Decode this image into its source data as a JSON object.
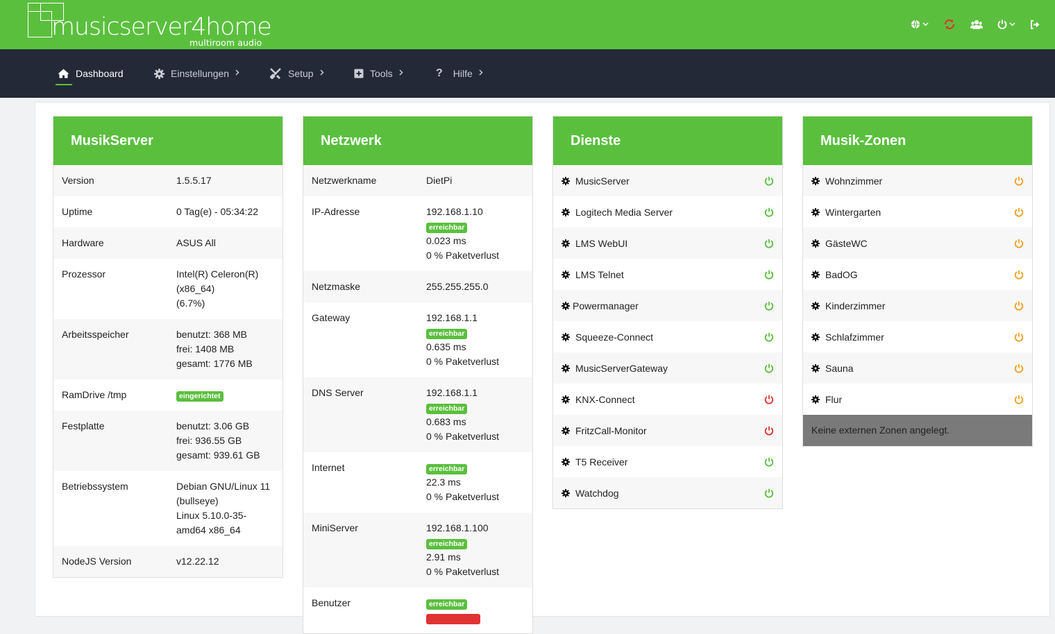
{
  "brand": {
    "name": "musicserver4home",
    "subtitle": "multiroom audio"
  },
  "topbar": {
    "icons": [
      "globe-icon",
      "sync-icon",
      "users-icon",
      "power-icon",
      "logout-icon"
    ],
    "sync_color": "#e03333"
  },
  "nav": {
    "items": [
      {
        "label": "Dashboard",
        "icon": "home-icon"
      },
      {
        "label": "Einstellungen",
        "icon": "gear-icon"
      },
      {
        "label": "Setup",
        "icon": "tools-icon"
      },
      {
        "label": "Tools",
        "icon": "plus-square-icon"
      },
      {
        "label": "Hilfe",
        "icon": "question-icon"
      }
    ]
  },
  "musikserver": {
    "title": "MusikServer",
    "rows": [
      {
        "k": "Version",
        "v": [
          "1.5.5.17"
        ]
      },
      {
        "k": "Uptime",
        "v": [
          "0 Tag(e) - 05:34:22"
        ]
      },
      {
        "k": "Hardware",
        "v": [
          "ASUS All"
        ]
      },
      {
        "k": "Prozessor",
        "v": [
          "Intel(R) Celeron(R)",
          "(x86_64)",
          "(6.7%)"
        ]
      },
      {
        "k": "Arbeitsspeicher",
        "v": [
          "benutzt: 368 MB",
          "frei: 1408 MB",
          "gesamt: 1776 MB"
        ]
      },
      {
        "k": "RamDrive /tmp",
        "badge": "eingerichtet"
      },
      {
        "k": "Festplatte",
        "v": [
          "benutzt: 3.06 GB",
          "frei: 936.55 GB",
          "gesamt: 939.61 GB"
        ]
      },
      {
        "k": "Betriebssystem",
        "v": [
          "Debian GNU/Linux 11",
          "(bullseye)",
          "Linux 5.10.0-35-",
          "amd64 x86_64"
        ]
      },
      {
        "k": "NodeJS Version",
        "v": [
          "v12.22.12"
        ]
      }
    ]
  },
  "netzwerk": {
    "title": "Netzwerk",
    "rows": [
      {
        "k": "Netzwerkname",
        "v": [
          "DietPi"
        ]
      },
      {
        "k": "IP-Adresse",
        "v": [
          "192.168.1.10"
        ],
        "badge": "erreichbar",
        "after": [
          "0.023 ms",
          "0 % Paketverlust"
        ]
      },
      {
        "k": "Netzmaske",
        "v": [
          "255.255.255.0"
        ]
      },
      {
        "k": "Gateway",
        "v": [
          "192.168.1.1"
        ],
        "badge": "erreichbar",
        "after": [
          "0.635 ms",
          "0 % Paketverlust"
        ]
      },
      {
        "k": "DNS Server",
        "v": [
          "192.168.1.1"
        ],
        "badge": "erreichbar",
        "after": [
          "0.683 ms",
          "0 % Paketverlust"
        ]
      },
      {
        "k": "Internet",
        "badge": "erreichbar",
        "after": [
          "22.3 ms",
          "0 % Paketverlust"
        ]
      },
      {
        "k": "MiniServer",
        "v": [
          "192.168.1.100"
        ],
        "badge": "erreichbar",
        "after": [
          "2.91 ms",
          "0 % Paketverlust"
        ]
      },
      {
        "k": "Benutzer",
        "badge": "erreichbar"
      }
    ]
  },
  "dienste": {
    "title": "Dienste",
    "items": [
      {
        "label": "MusicServer",
        "status": "on"
      },
      {
        "label": "Logitech Media Server",
        "status": "on"
      },
      {
        "label": "LMS WebUI",
        "status": "on"
      },
      {
        "label": "LMS Telnet",
        "status": "on"
      },
      {
        "label": "Powermanager",
        "status": "on"
      },
      {
        "label": "Squeeze-Connect",
        "status": "on"
      },
      {
        "label": "MusicServerGateway",
        "status": "on"
      },
      {
        "label": "KNX-Connect",
        "status": "off"
      },
      {
        "label": "FritzCall-Monitor",
        "status": "off"
      },
      {
        "label": "T5 Receiver",
        "status": "on"
      },
      {
        "label": "Watchdog",
        "status": "on"
      }
    ]
  },
  "zonen": {
    "title": "Musik-Zonen",
    "items": [
      "Wohnzimmer",
      "Wintergarten",
      "GästeWC",
      "BadOG",
      "Kinderzimmer",
      "Schlafzimmer",
      "Sauna",
      "Flur"
    ],
    "footer": "Keine externen Zonen angelegt."
  },
  "colors": {
    "green": "#5bbf3e",
    "red": "#e03333",
    "orange": "#f0a020",
    "nav": "#232936"
  }
}
